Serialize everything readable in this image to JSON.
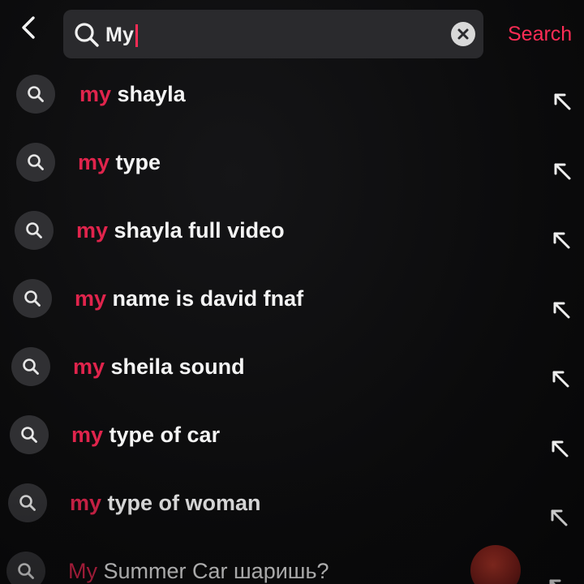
{
  "header": {
    "back_icon": "chevron-left-icon",
    "search_icon": "search-icon",
    "query": "My",
    "clear_icon": "close-icon",
    "search_label": "Search",
    "accent_color": "#fe2c55"
  },
  "suggestions": [
    {
      "prefix": "my",
      "rest": " shayla"
    },
    {
      "prefix": "my",
      "rest": " type"
    },
    {
      "prefix": "my",
      "rest": " shayla full video"
    },
    {
      "prefix": "my",
      "rest": " name is david fnaf"
    },
    {
      "prefix": "my",
      "rest": " sheila sound"
    },
    {
      "prefix": "my",
      "rest": " type of car"
    },
    {
      "prefix": "my",
      "rest": " type of woman"
    },
    {
      "prefix": "My",
      "rest": " Summer Car шаришь?"
    }
  ],
  "suggestion_icon": "search-icon",
  "fill_icon": "arrow-up-left-icon"
}
